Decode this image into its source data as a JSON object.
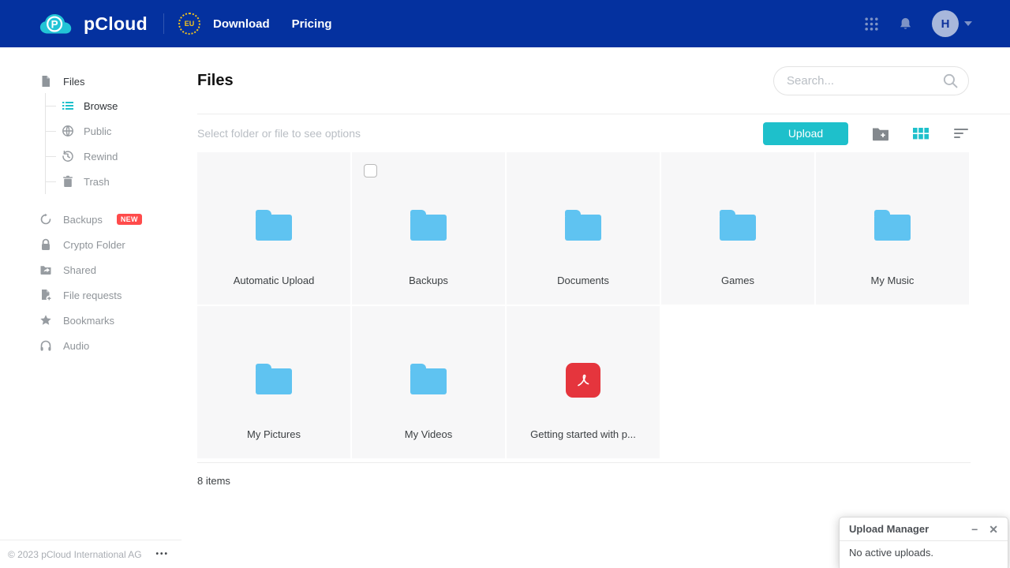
{
  "navbar": {
    "brand": "pCloud",
    "region_badge": "EU",
    "links": [
      {
        "label": "Download"
      },
      {
        "label": "Pricing"
      }
    ],
    "avatar_letter": "H"
  },
  "sidebar": {
    "files_root": "Files",
    "tree_children": [
      {
        "label": "Browse",
        "icon": "browse-list-icon",
        "active": true
      },
      {
        "label": "Public",
        "icon": "globe-icon"
      },
      {
        "label": "Rewind",
        "icon": "rewind-clock-icon"
      },
      {
        "label": "Trash",
        "icon": "trash-icon"
      }
    ],
    "items": [
      {
        "label": "Backups",
        "icon": "backup-arrow-icon",
        "badge": "NEW"
      },
      {
        "label": "Crypto Folder",
        "icon": "lock-icon"
      },
      {
        "label": "Shared",
        "icon": "shared-folder-icon"
      },
      {
        "label": "File requests",
        "icon": "file-request-icon"
      },
      {
        "label": "Bookmarks",
        "icon": "star-icon"
      },
      {
        "label": "Audio",
        "icon": "headphones-icon"
      }
    ],
    "copyright": "© 2023 pCloud International AG"
  },
  "main": {
    "title": "Files",
    "search_placeholder": "Search...",
    "toolbar": {
      "hint": "Select folder or file to see options",
      "upload_label": "Upload"
    },
    "files": [
      {
        "name": "Automatic Upload",
        "type": "folder"
      },
      {
        "name": "Backups",
        "type": "folder",
        "checkbox": true
      },
      {
        "name": "Documents",
        "type": "folder"
      },
      {
        "name": "Games",
        "type": "folder"
      },
      {
        "name": "My Music",
        "type": "folder"
      },
      {
        "name": "My Pictures",
        "type": "folder"
      },
      {
        "name": "My Videos",
        "type": "folder"
      },
      {
        "name": "Getting started with p...",
        "type": "pdf"
      }
    ],
    "items_count": "8 items"
  },
  "upload_manager": {
    "title": "Upload Manager",
    "status": "No active uploads.",
    "minimize_label": "−",
    "close_label": "✕"
  },
  "colors": {
    "navbar_bg": "#04319f",
    "accent_teal": "#1ec0cb",
    "folder_blue": "#5fc3f1",
    "pdf_red": "#e5353d",
    "new_badge_red": "#ff4b4b"
  }
}
